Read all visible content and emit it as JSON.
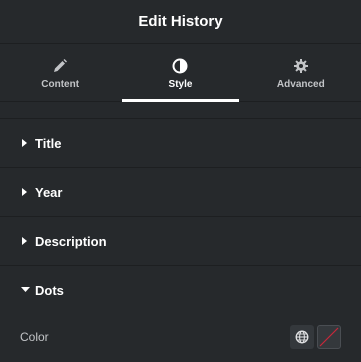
{
  "header": {
    "title": "Edit History"
  },
  "tabs": [
    {
      "label": "Content",
      "icon": "pencil-icon",
      "active": false
    },
    {
      "label": "Style",
      "icon": "half-circle-icon",
      "active": true
    },
    {
      "label": "Advanced",
      "icon": "gear-icon",
      "active": false
    }
  ],
  "sections": [
    {
      "label": "Title",
      "open": false
    },
    {
      "label": "Year",
      "open": false
    },
    {
      "label": "Description",
      "open": false
    },
    {
      "label": "Dots",
      "open": true
    }
  ],
  "dots_controls": {
    "color_label": "Color",
    "global_icon": "globe-icon",
    "swatch_state": "empty"
  },
  "colors": {
    "panel_bg": "#26292c",
    "divider": "#1d1f21",
    "active_tab_indicator": "#ffffff",
    "empty_swatch_slash": "#c8273a"
  }
}
